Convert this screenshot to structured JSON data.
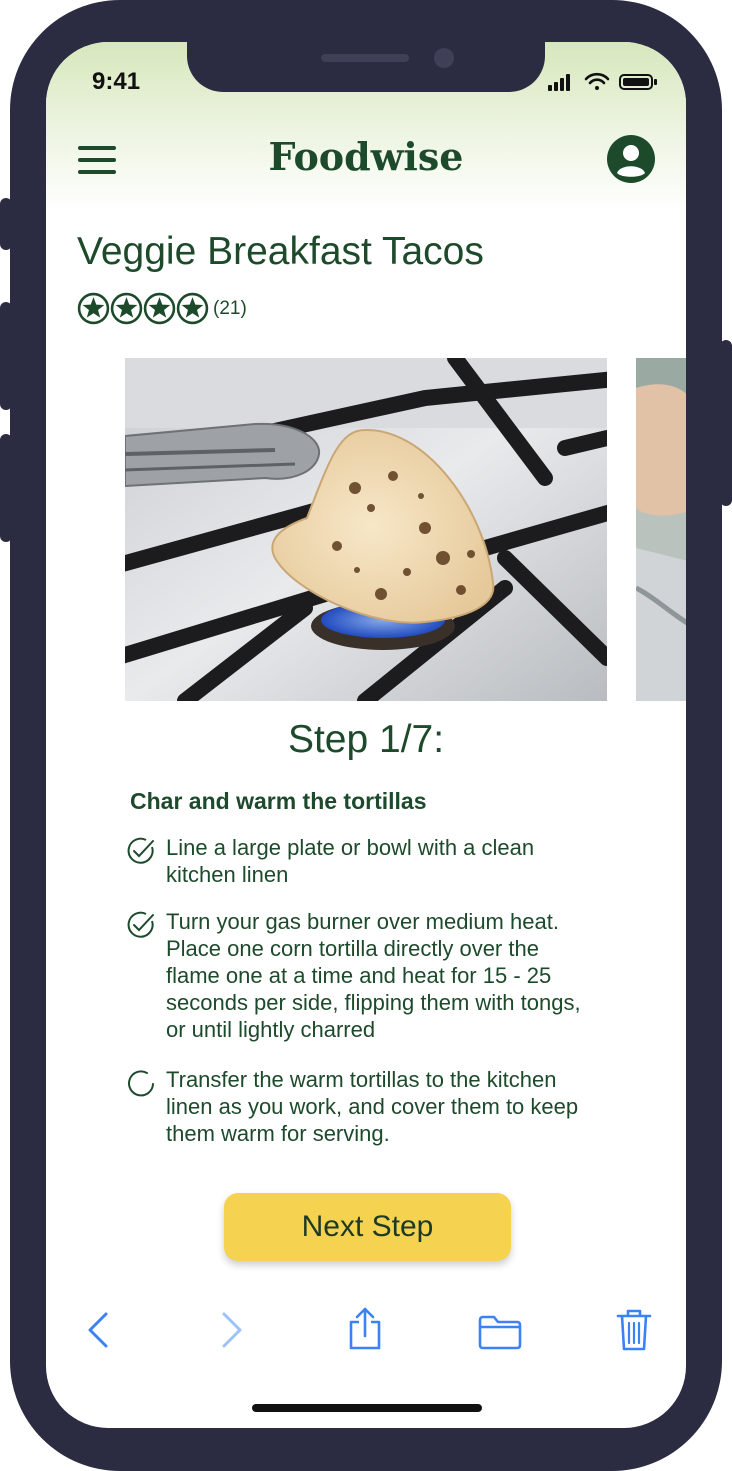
{
  "status_bar": {
    "time": "9:41"
  },
  "header": {
    "app_title": "Foodwise"
  },
  "recipe": {
    "title": "Veggie Breakfast Tacos",
    "rating_stars": 4,
    "rating_count": "(21)"
  },
  "step": {
    "label": "Step 1/7:",
    "heading": "Char and warm the tortillas",
    "tasks": [
      {
        "text": "Line a large plate or bowl with a clean kitchen linen",
        "done": true
      },
      {
        "text": "Turn your gas burner over medium heat. Place one corn tortilla directly over the flame one at a time and heat for 15 - 25 seconds per side, flipping them with tongs, or until lightly charred",
        "done": true
      },
      {
        "text": "Transfer the warm tortillas to the kitchen linen as you work, and cover them to keep them warm for serving.",
        "done": false
      }
    ]
  },
  "actions": {
    "next_label": "Next Step"
  },
  "toolbar": {
    "icons": [
      "back-icon",
      "forward-icon",
      "share-icon",
      "folder-icon",
      "trash-icon"
    ]
  },
  "colors": {
    "brand_green": "#1e4a2c",
    "button_yellow": "#f5d250",
    "toolbar_blue": "#3b82f6",
    "phone_frame": "#2b2b41"
  }
}
